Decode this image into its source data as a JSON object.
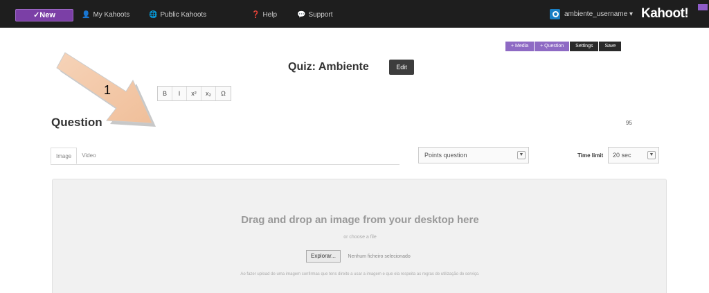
{
  "nav": {
    "new_label": "✓New",
    "items": [
      {
        "icon": "user-icon",
        "glyph": "👤",
        "label": "My Kahoots"
      },
      {
        "icon": "globe-icon",
        "glyph": "🌐",
        "label": "Public Kahoots"
      },
      {
        "icon": "help-icon",
        "glyph": "❓",
        "label": "Help"
      },
      {
        "icon": "speech-icon",
        "glyph": "💬",
        "label": "Support"
      }
    ],
    "username": "ambiente_username ▾",
    "logo": "Kahoot!"
  },
  "actions": [
    {
      "label": "+ Media",
      "style": "purple"
    },
    {
      "label": "+ Question",
      "style": "purple"
    },
    {
      "label": "Settings",
      "style": "dark"
    },
    {
      "label": "Save",
      "style": "dark"
    }
  ],
  "quiz": {
    "title": "Quiz: Ambiente",
    "edit_label": "Edit"
  },
  "format_toolbar": [
    "B",
    "I",
    "x²",
    "x₂",
    "Ω"
  ],
  "annotation": {
    "number": "1"
  },
  "question": {
    "heading": "Question",
    "char_count": "95"
  },
  "media_tabs": [
    {
      "label": "Image",
      "active": true
    },
    {
      "label": "Video",
      "active": false
    }
  ],
  "points": {
    "selected": "Points question"
  },
  "time_limit": {
    "label": "Time limit",
    "selected": "20 sec"
  },
  "dropzone": {
    "title": "Drag and drop an image from your desktop here",
    "or_text": "or choose a file",
    "browse_label": "Explorar...",
    "file_status": "Nenhum ficheiro selecionado",
    "note": "Ao fazer upload de uma imagem confirmas que tens direito a usar a imagem e que ela respeita as regras de utilização do serviço."
  },
  "colors": {
    "topbar": "#1e1e1e",
    "accent": "#7b3fa6",
    "media_button": "#8e6ac4",
    "dropzone_bg": "#f1f1f1"
  }
}
